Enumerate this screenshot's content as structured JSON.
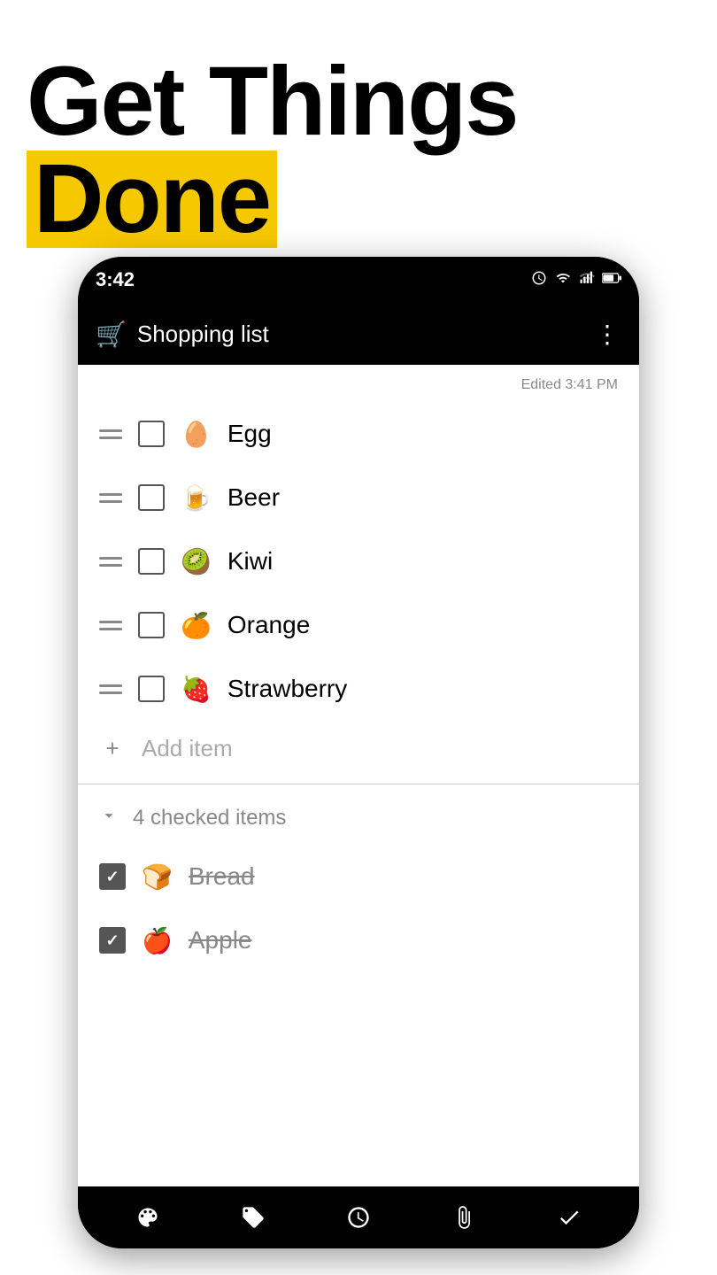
{
  "header": {
    "title_normal": "Get Things ",
    "title_highlight": "Done"
  },
  "status_bar": {
    "time": "3:42",
    "icons": [
      "alarm",
      "wifi",
      "signal",
      "battery"
    ]
  },
  "app_bar": {
    "title": "Shopping list",
    "cart_emoji": "🛒",
    "more_label": "⋮"
  },
  "list": {
    "edited_label": "Edited 3:41 PM",
    "items": [
      {
        "id": 1,
        "emoji": "🥚",
        "label": "Egg",
        "checked": false
      },
      {
        "id": 2,
        "emoji": "🍺",
        "label": "Beer",
        "checked": false
      },
      {
        "id": 3,
        "emoji": "🥝",
        "label": "Kiwi",
        "checked": false
      },
      {
        "id": 4,
        "emoji": "🍊",
        "label": "Orange",
        "checked": false
      },
      {
        "id": 5,
        "emoji": "🍓",
        "label": "Strawberry",
        "checked": false
      }
    ],
    "add_item_label": "Add item",
    "add_icon": "+",
    "checked_count_label": "4 checked items",
    "checked_items": [
      {
        "id": 6,
        "emoji": "🍞",
        "label": "Bread",
        "checked": true
      },
      {
        "id": 7,
        "emoji": "🍎",
        "label": "Apple",
        "checked": true
      }
    ]
  },
  "bottom_nav": {
    "icons": [
      "palette",
      "tag",
      "alarm",
      "paperclip",
      "checkmark"
    ]
  }
}
